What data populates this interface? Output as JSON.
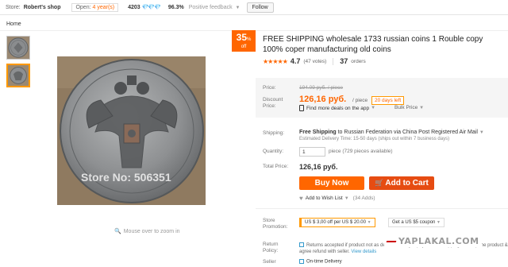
{
  "topbar": {
    "store_label": "Store:",
    "store_name": "Robert's shop",
    "open_prefix": "Open:",
    "open_years": "4 year(s)",
    "score": "4203",
    "diamonds": "💎💎💎",
    "feedback_pct": "96.3%",
    "feedback_label": "Positive feedback",
    "follow_label": "Follow"
  },
  "breadcrumb": "Home",
  "gallery": {
    "zoom_hint": "Mouse over to zoom in",
    "image_text": "Store No: 506351"
  },
  "discount_tag": {
    "value": "35",
    "pct": "%",
    "off": "off"
  },
  "product": {
    "title": "FREE SHIPPING wholesale 1733 russian coins 1 Rouble copy 100% coper manufacturing old coins",
    "stars": "★★★★★",
    "rating": "4.7",
    "votes": "(47 votes)",
    "orders_count": "37",
    "orders_label": "orders"
  },
  "price": {
    "price_label": "Price:",
    "old_price": "194.09 руб. / piece",
    "discount_label": "Discount Price:",
    "new_price": "126,16 руб.",
    "per_piece": "/ piece",
    "days_left": "20 days left",
    "mobile_deal": "Find more deals on the app",
    "bulk_price": "Bulk Price"
  },
  "shipping": {
    "label": "Shipping:",
    "free": "Free Shipping",
    "to": " to ",
    "destination": "Russian Federation via China Post Registered Air Mail",
    "delivery": "Estimated Delivery Time: 15-50 days (ships out within 7 business days)"
  },
  "quantity": {
    "label": "Quantity:",
    "value": "1",
    "note": "piece (729 pieces available)"
  },
  "total": {
    "label": "Total Price:",
    "value": "126,16 руб."
  },
  "buttons": {
    "buy_now": "Buy Now",
    "add_to_cart": "Add to Cart",
    "cart_icon": "🛒"
  },
  "wishlist": {
    "label": "Add to Wish List",
    "adds": "(34 Adds)"
  },
  "promotion": {
    "label": "Store Promotion:",
    "coupon1": "US $ 3,00 off per US $ 20.00",
    "coupon2": "Get a US $5 coupon"
  },
  "returns": {
    "label": "Return Policy:",
    "text": "Returns accepted if product not as described, buyer pays return shipping; or keep the product & agree refund with seller.",
    "details": "View details"
  },
  "seller_guarantees": {
    "label": "Seller",
    "ontime": "On-time Delivery"
  },
  "watermark": "YAPLAKAL.COM",
  "colors": {
    "accent": "#ff6600",
    "cart": "#e64c12",
    "link": "#3399cc"
  }
}
